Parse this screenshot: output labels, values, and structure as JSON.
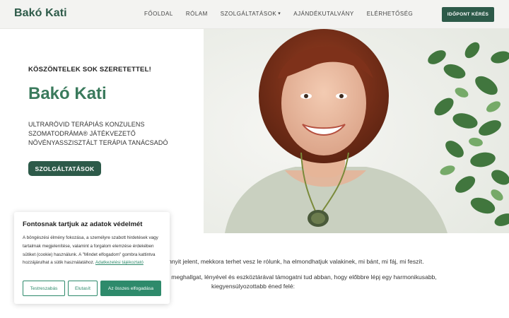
{
  "header": {
    "logo": "Bakó Kati",
    "nav": [
      {
        "label": "Főoldal",
        "dropdown": false
      },
      {
        "label": "Rólam",
        "dropdown": false
      },
      {
        "label": "Szolgáltatások",
        "dropdown": true
      },
      {
        "label": "Ajándékutalvány",
        "dropdown": false
      },
      {
        "label": "Elérhetőség",
        "dropdown": false
      }
    ],
    "cta": "Időpont kérés"
  },
  "hero": {
    "greeting": "KÖSZÖNTELEK SOK SZERETETTEL!",
    "name": "Bakó Kati",
    "roles": [
      "ULTRARÖVID TERÁPIÁS KONZULENS",
      "SZOMATODRÁMA® JÁTÉKVEZETŐ",
      "NÖVÉNYASSZISZTÁLT TERÁPIA TANÁCSADÓ"
    ],
    "button": "Szolgáltatások",
    "photo": "portrait-photo"
  },
  "content": {
    "line1": "nnyit jelent, mekkora terhet vesz le rólunk, ha elmondhatjuk valakinek, mi bánt, mi fáj, mi feszít.",
    "line2": "l meghallgat, lényével és eszköztárával támogatni tud abban, hogy előbbre lépj egy harmonikusabb,",
    "line3": "kiegyensúlyozottabb éned felé:"
  },
  "cookie": {
    "title": "Fontosnak tartjuk az adatok védelmét",
    "text": "A böngészési élmény fokozása, a személyre szabott hirdetések vagy tartalmak megjelenítése, valamint a forgalom elemzése érdekében sütiket (cookie) használunk. A \"Mindet elfogadom\" gombra kattintva hozzájárulhat a sütik használatához.",
    "link": "Adatkezelési tájékoztató",
    "buttons": {
      "settings": "Testreszabás",
      "reject": "Elutasít",
      "accept": "Az összes elfogadása"
    }
  },
  "colors": {
    "brand": "#2d5a49",
    "accent": "#3a7a5c",
    "cookie_accent": "#2e8a6b",
    "header_bg": "#f3f3f1"
  }
}
